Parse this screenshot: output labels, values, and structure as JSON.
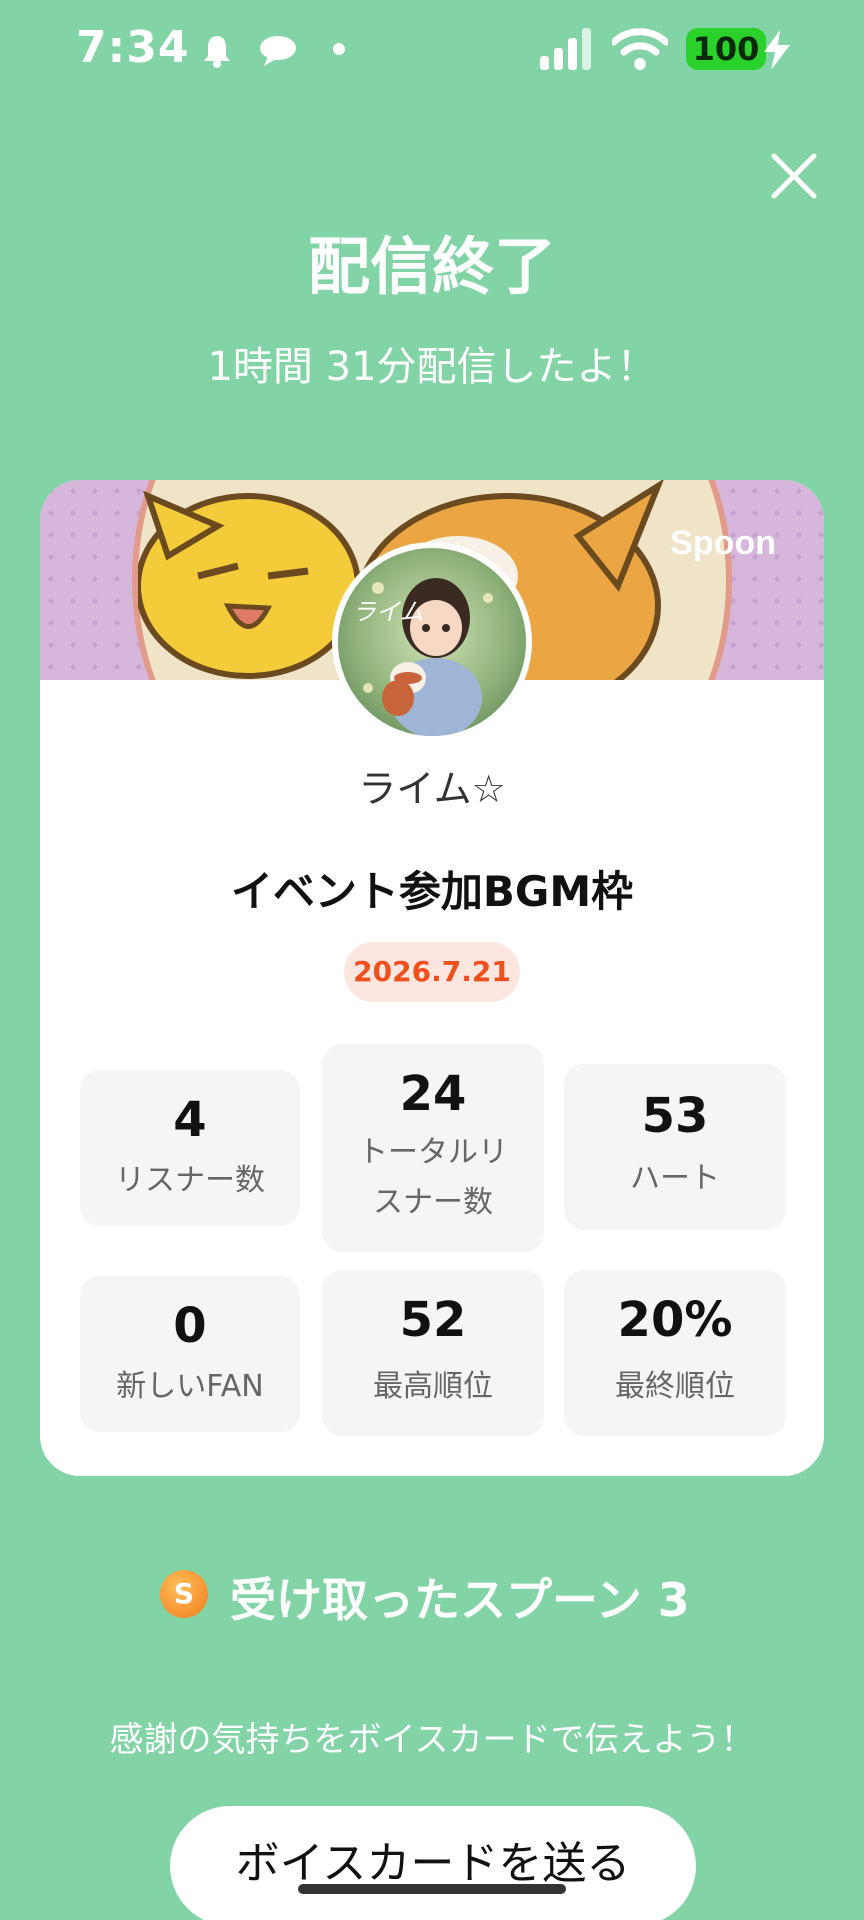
{
  "status_bar": {
    "time": "7:34",
    "battery": "100",
    "icons": [
      "bell-icon",
      "chat-bubble-icon",
      "dot-icon",
      "signal-icon",
      "wifi-icon",
      "battery-icon",
      "charging-bolt-icon"
    ]
  },
  "header": {
    "title": "配信終了",
    "subtitle": "1時間 31分配信したよ！",
    "close_icon": "close-icon"
  },
  "card": {
    "brand": "Spoon",
    "avatar_text": "ライム",
    "username": "ライム☆",
    "live_title": "イベント参加BGM枠",
    "date": "2026.7.21",
    "stats": [
      {
        "value": "4",
        "label": "リスナー数"
      },
      {
        "value": "24",
        "label_line1": "トータルリ",
        "label_line2": "スナー数"
      },
      {
        "value": "53",
        "label": "ハート"
      },
      {
        "value": "0",
        "label": "新しいFAN"
      },
      {
        "value": "52",
        "label": "最高順位"
      },
      {
        "value": "20%",
        "label": "最終順位"
      }
    ]
  },
  "spoons": {
    "coin_letter": "S",
    "text": "受け取ったスプーン 3"
  },
  "thanks_text": "感謝の気持ちをボイスカードで伝えよう！",
  "voice_button": "ボイスカードを送る",
  "colors": {
    "background": "#82d3a6",
    "date_pill_bg": "#fde6df",
    "date_pill_text": "#f0501e",
    "battery": "#2bd12b"
  }
}
